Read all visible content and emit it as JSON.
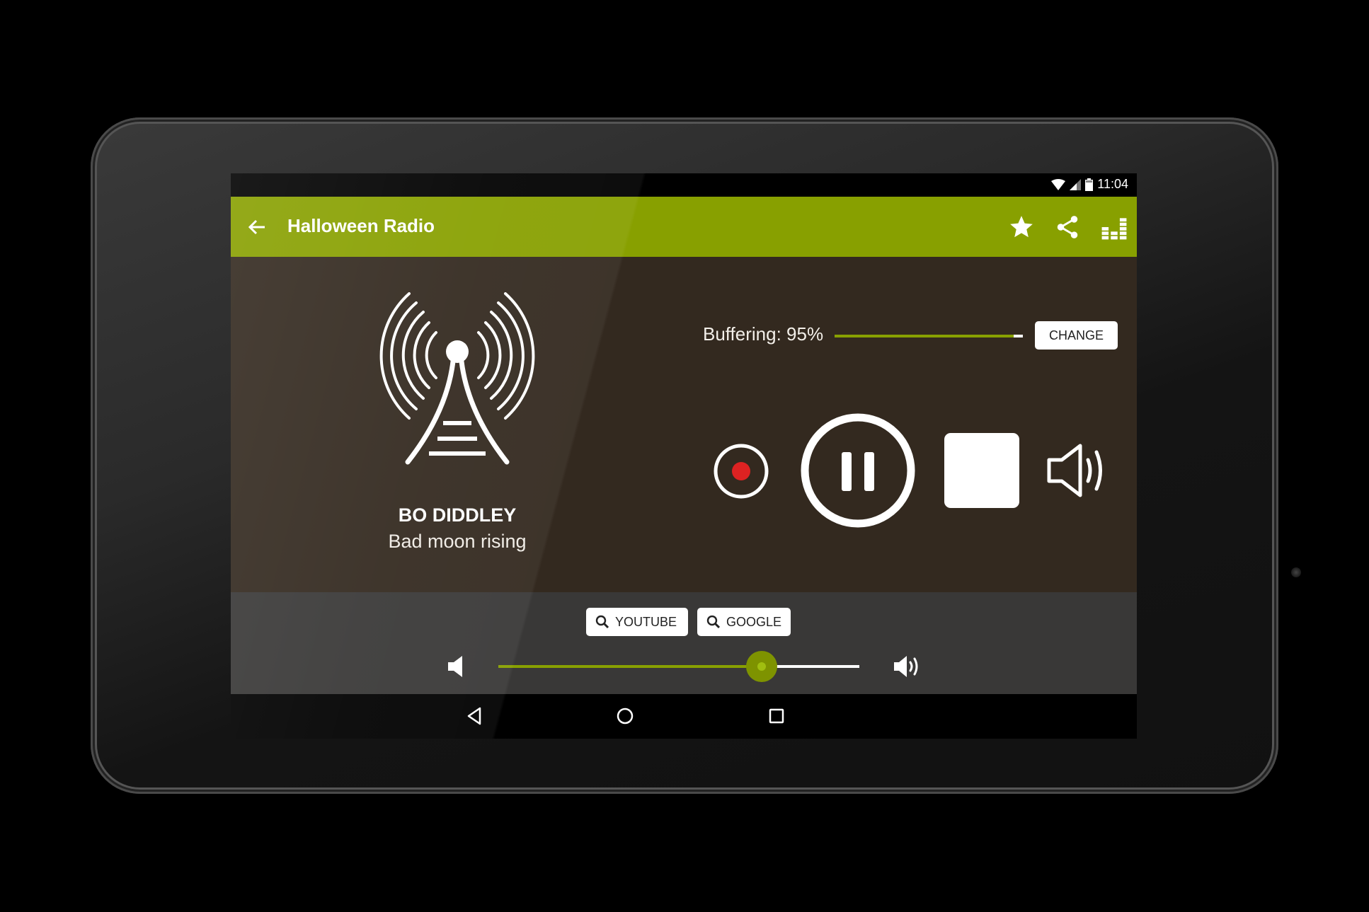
{
  "status_bar": {
    "time": "11:04",
    "icons": [
      "wifi-icon",
      "cell-signal-icon",
      "battery-icon"
    ]
  },
  "toolbar": {
    "back_icon": "arrow-left-icon",
    "title": "Halloween Radio",
    "actions": [
      {
        "name": "favorite",
        "icon": "star-icon"
      },
      {
        "name": "share",
        "icon": "share-icon"
      },
      {
        "name": "equalizer",
        "icon": "equalizer-icon"
      }
    ],
    "color": "#88a000"
  },
  "now_playing": {
    "station_icon": "radio-tower-icon",
    "artist": "BO DIDDLEY",
    "song": "Bad moon rising"
  },
  "buffering": {
    "label": "Buffering: 95%",
    "progress": 0.95,
    "change_label": "CHANGE"
  },
  "controls": {
    "record_icon": "record-icon",
    "pause_icon": "pause-icon",
    "stop_icon": "stop-icon",
    "volume_icon": "speaker-icon",
    "record_color": "#dd2222"
  },
  "search": {
    "youtube_label": "YOUTUBE",
    "google_label": "GOOGLE"
  },
  "volume": {
    "value": 0.73,
    "low_icon": "volume-low-icon",
    "high_icon": "volume-high-icon"
  },
  "nav_bar": {
    "back": "nav-back-icon",
    "home": "nav-home-icon",
    "recents": "nav-recents-icon"
  }
}
